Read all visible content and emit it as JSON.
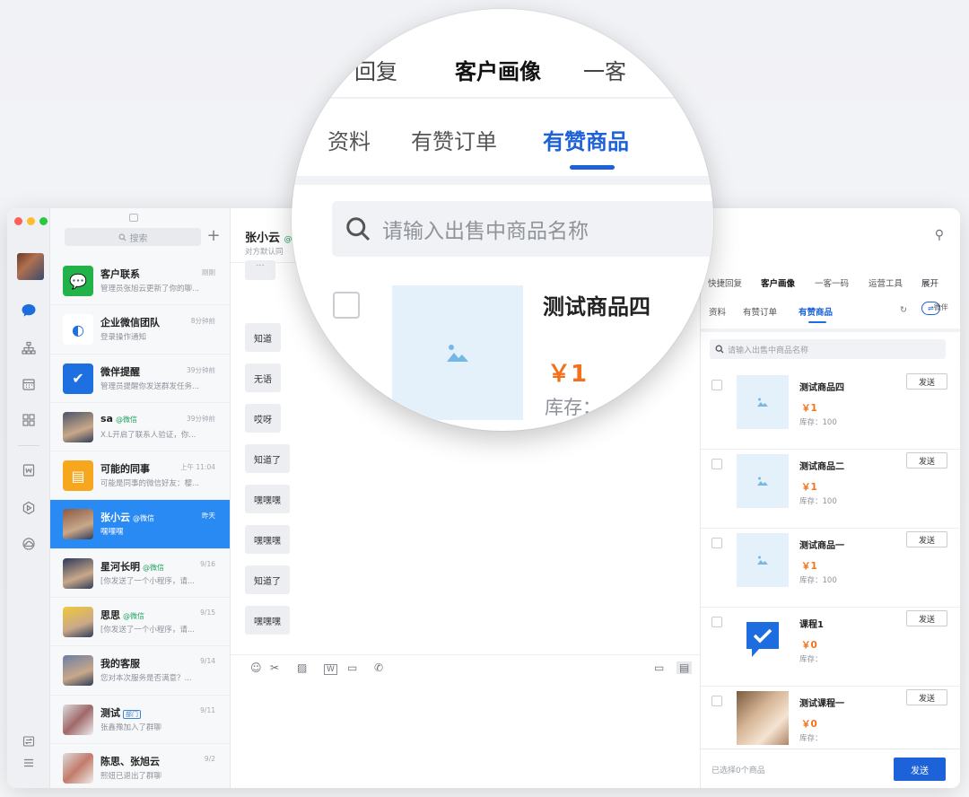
{
  "sidebar": {
    "avatar": "user-avatar"
  },
  "convlist": {
    "search_placeholder": "搜索",
    "add_label": "+",
    "items": [
      {
        "name": "客户联系",
        "tag": "",
        "time": "刚刚",
        "preview": "管理员张旭云更新了你的聊...",
        "icon": "chat-bubble-icon",
        "color": "#21b34a",
        "active": false
      },
      {
        "name": "企业微信团队",
        "tag": "",
        "time": "8分钟前",
        "preview": "登录操作通知",
        "icon": "wecom-logo-icon",
        "color": "#ffffff",
        "active": false
      },
      {
        "name": "微伴提醒",
        "tag": "",
        "time": "39分钟前",
        "preview": "管理员提醒你发送群发任务...",
        "icon": "check-bubble-icon",
        "color": "#1e6fe0",
        "active": false
      },
      {
        "name": "sa",
        "tag": "@微信",
        "time": "39分钟前",
        "preview": "X.L开启了联系人验证，你...",
        "icon": "photo-avatar",
        "color": "#4a5568",
        "active": false
      },
      {
        "name": "可能的同事",
        "tag": "",
        "time": "上午 11:04",
        "preview": "可能是同事的微信好友：樱...",
        "icon": "id-card-icon",
        "color": "#f7a71d",
        "active": false
      },
      {
        "name": "张小云",
        "tag": "@微信",
        "time": "昨天",
        "preview": "嘿嘿嘿",
        "icon": "photo-avatar",
        "color": "#8b5a44",
        "active": true
      },
      {
        "name": "星河长明",
        "tag": "@微信",
        "time": "9/16",
        "preview": "[你发送了一个小程序，请...",
        "icon": "photo-avatar",
        "color": "#2d3a5a",
        "active": false
      },
      {
        "name": "思思",
        "tag": "@微信",
        "time": "9/15",
        "preview": "[你发送了一个小程序，请...",
        "icon": "photo-avatar",
        "color": "#f0c93a",
        "active": false
      },
      {
        "name": "我的客服",
        "tag": "",
        "time": "9/14",
        "preview": "您对本次服务是否满意？...",
        "icon": "photo-avatar",
        "color": "#6b7fa3",
        "active": false
      },
      {
        "name": "测试",
        "tag": "部门",
        "time": "9/11",
        "preview": "张鑫豫加入了群聊",
        "icon": "group-avatar",
        "color": "#a0686a",
        "active": false
      },
      {
        "name": "陈思、张旭云",
        "tag": "",
        "time": "9/2",
        "preview": "熙妞已退出了群聊",
        "icon": "group-avatar",
        "color": "#c27b6a",
        "active": false
      }
    ]
  },
  "chat": {
    "title": "张小云",
    "title_tag": "@",
    "subtitle": "对方默认同",
    "messages": [
      "知道",
      "无语",
      "哎呀",
      "知道了",
      "嘿嘿嘿",
      "嘿嘿嘿",
      "知道了",
      "嘿嘿嘿"
    ]
  },
  "panel": {
    "tabs1": [
      "快捷回复",
      "客户画像",
      "一客一码",
      "运营工具",
      "展开"
    ],
    "tabs2": [
      "资料",
      "有赞订单",
      "有赞商品"
    ],
    "tab2_extra": "微伴",
    "search_placeholder": "请输入出售中商品名称",
    "products": [
      {
        "name": "测试商品四",
        "price": "￥1",
        "stock": "库存：100",
        "thumb": "placeholder"
      },
      {
        "name": "测试商品二",
        "price": "￥1",
        "stock": "库存：100",
        "thumb": "placeholder"
      },
      {
        "name": "测试商品一",
        "price": "￥1",
        "stock": "库存：100",
        "thumb": "placeholder"
      },
      {
        "name": "课程1",
        "price": "￥0",
        "stock": "库存：",
        "thumb": "check-bubble"
      },
      {
        "name": "测试课程一",
        "price": "￥0",
        "stock": "库存：",
        "thumb": "photo"
      }
    ],
    "send_label": "发送",
    "selected_text": "已选择0个商品",
    "send_primary": "发送"
  },
  "magnifier": {
    "tabs1": [
      "回复",
      "客户画像",
      "一客"
    ],
    "tabs2": [
      "资料",
      "有赞订单",
      "有赞商品"
    ],
    "search_placeholder": "请输入出售中商品名称",
    "product_name": "测试商品四",
    "product_price": "￥1",
    "product_stock": "库存："
  },
  "colors": {
    "accent": "#1d62d8",
    "active_row": "#2a8af4",
    "price": "#f2711c",
    "wechat_tag": "#21a362"
  }
}
